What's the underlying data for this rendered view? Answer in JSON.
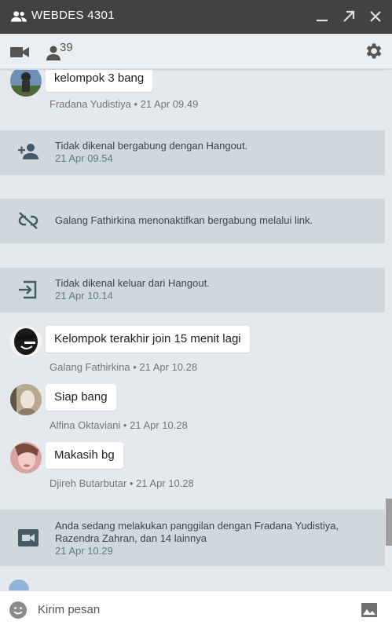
{
  "window": {
    "title": "WEBDES 4301",
    "icons": [
      "group-icon",
      "minimize-icon",
      "popout-icon",
      "close-icon"
    ]
  },
  "toolbar": {
    "participant_count": "39",
    "icons": [
      "video-call-icon",
      "people-icon",
      "settings-icon"
    ]
  },
  "messages": [
    {
      "type": "message",
      "sender": "Fradana Yudistiya",
      "text": "kelompok 3 bang",
      "time": "21 Apr 09.49",
      "meta": "Fradana Yudistiya • 21 Apr 09.49"
    },
    {
      "type": "event",
      "icon": "person-add-icon",
      "text": "Tidak dikenal bergabung dengan Hangout.",
      "time": "21 Apr 09.54"
    },
    {
      "type": "event",
      "icon": "link-off-icon",
      "text": "Galang Fathirkina menonaktifkan bergabung melalui link.",
      "time": ""
    },
    {
      "type": "event",
      "icon": "exit-icon",
      "text": "Tidak dikenal keluar dari Hangout.",
      "time": "21 Apr 10.14"
    },
    {
      "type": "message",
      "sender": "Galang Fathirkina",
      "text": "Kelompok terakhir join 15 menit lagi",
      "time": "21 Apr 10.28",
      "meta": "Galang Fathirkina • 21 Apr 10.28"
    },
    {
      "type": "message",
      "sender": "Alfina Oktaviani",
      "text": "Siap bang",
      "time": "21 Apr 10.28",
      "meta": "Alfina Oktaviani • 21 Apr 10.28"
    },
    {
      "type": "message",
      "sender": "Djireh Butarbutar",
      "text": "Makasih bg",
      "time": "21 Apr 10.28",
      "meta": "Djireh Butarbutar • 21 Apr 10.28"
    },
    {
      "type": "event",
      "icon": "videocam-icon",
      "text_line1": "Anda sedang melakukan panggilan dengan Fradana Yudistiya,",
      "text_line2": "Razendra Zahran, dan 14 lainnya",
      "time": "21 Apr 10.29"
    }
  ],
  "compose": {
    "placeholder": "Kirim pesan",
    "value": "",
    "icons": [
      "emoji-icon",
      "image-icon"
    ]
  },
  "colors": {
    "titlebar": "#424242",
    "toolbar": "#eceff1",
    "background": "#e5e9ed",
    "event_bg": "#cfd8dc",
    "bubble": "#ffffff"
  }
}
